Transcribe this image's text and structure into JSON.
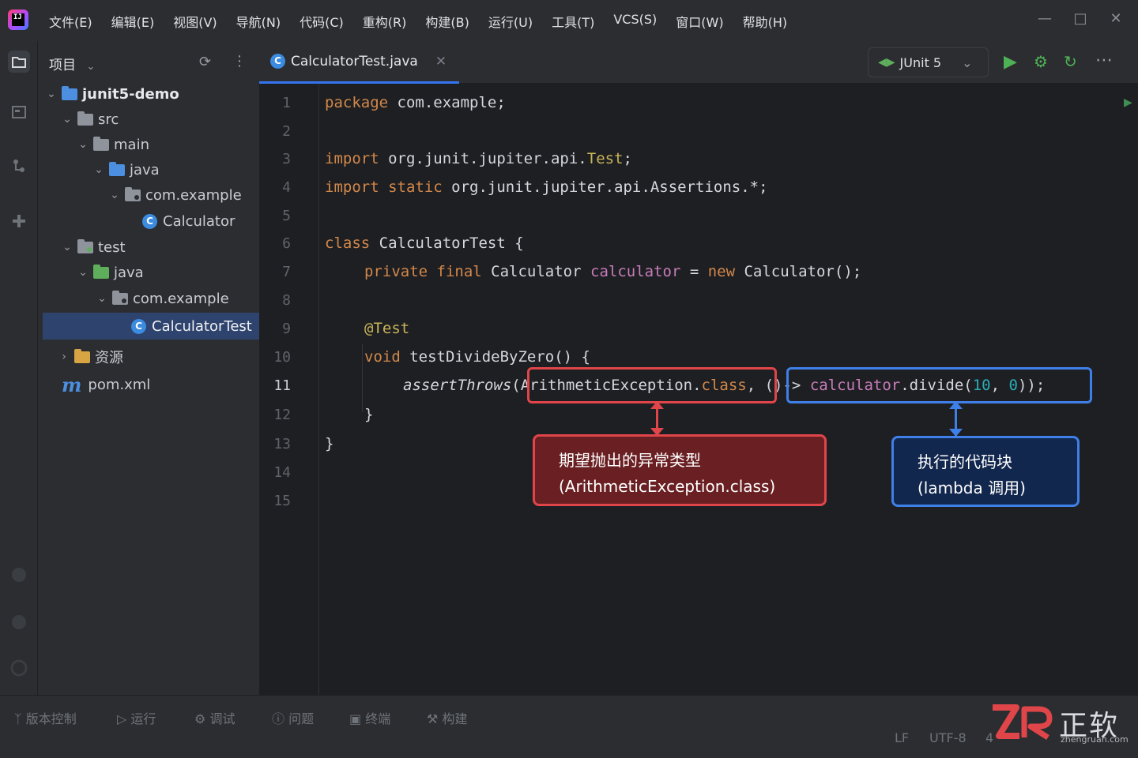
{
  "menu": [
    "文件(E)",
    "编辑(E)",
    "视图(V)",
    "导航(N)",
    "代码(C)",
    "重构(R)",
    "构建(B)",
    "运行(U)",
    "工具(T)",
    "VCS(S)",
    "窗口(W)",
    "帮助(H)"
  ],
  "project": {
    "header": "项目",
    "tree": [
      {
        "label": "junit5-demo",
        "depth": 0,
        "icon": "folder-module-icon",
        "expanded": true
      },
      {
        "label": "src",
        "depth": 1,
        "icon": "folder-icon",
        "expanded": true
      },
      {
        "label": "main",
        "depth": 2,
        "icon": "folder-icon",
        "expanded": true
      },
      {
        "label": "java",
        "depth": 3,
        "icon": "source-folder-icon",
        "expanded": true
      },
      {
        "label": "com.example",
        "depth": 4,
        "icon": "package-icon",
        "expanded": true
      },
      {
        "label": "Calculator",
        "depth": 5,
        "icon": "class-icon"
      },
      {
        "label": "test",
        "depth": 1,
        "icon": "folder-icon",
        "expanded": true
      },
      {
        "label": "java",
        "depth": 2,
        "icon": "test-source-folder-icon",
        "expanded": true
      },
      {
        "label": "com.example",
        "depth": 3,
        "icon": "package-icon",
        "expanded": true
      },
      {
        "label": "CalculatorTest",
        "depth": 4,
        "icon": "class-icon",
        "selected": true
      },
      {
        "label": "资源",
        "depth": 1,
        "icon": "resources-folder-icon",
        "expanded": false
      },
      {
        "label": "pom.xml",
        "depth": 0,
        "icon": "maven-icon"
      }
    ]
  },
  "editor": {
    "tab": "CalculatorTest.java",
    "run_config": "JUnit 5",
    "current_line": 11,
    "line_numbers": [
      "1",
      "2",
      "3",
      "4",
      "5",
      "6",
      "7",
      "8",
      "9",
      "10",
      "11",
      "12",
      "13",
      "14",
      "15"
    ]
  },
  "code": {
    "l1_kw": "package",
    "l1_rest": " com.example;",
    "l3_kw": "import",
    "l3_rest": " org.junit.jupiter.api.",
    "l3_cls": "Test",
    "l3_end": ";",
    "l4_kw": "import static",
    "l4_rest": " org.junit.jupiter.api.Assertions.*;",
    "l6_kw": "class",
    "l6_rest": " CalculatorTest {",
    "l7_kw": "private final",
    "l7_type": " Calculator ",
    "l7_field": "calculator",
    "l7_eq": " = ",
    "l7_new": "new",
    "l7_rest": " Calculator();",
    "l9_ann": "@Test",
    "l10_kw": "void",
    "l10_rest": " testDivideByZero() {",
    "l11_call": "assertThrows",
    "l11_paren": "(",
    "l11_exc": "ArithmeticException.",
    "l11_class": "class",
    "l11_comma": ",",
    "l11_lambda": " ()->",
    "l11_field": " calculator",
    "l11_call2": ".divide(",
    "l11_n1": "10",
    "l11_sep": ", ",
    "l11_n2": "0",
    "l11_end": "));",
    "l12": "}",
    "l13": "}"
  },
  "callouts": {
    "red_line1": "期望抛出的异常类型",
    "red_line2": "(ArithmeticException.class)",
    "blue_line1": "执行的代码块",
    "blue_line2": "(lambda 调用)"
  },
  "bottom": {
    "tools": [
      "版本控制",
      "运行",
      "调试",
      "问题",
      "终端",
      "构建"
    ],
    "status_lf": "LF",
    "status_encoding": "UTF-8",
    "status_indent": "4"
  },
  "watermark": {
    "brand": "正软",
    "site": "zhengruan.com"
  },
  "colors": {
    "accent": "#3574f0",
    "highlight_red": "#e0454a",
    "highlight_blue": "#3f7fe8",
    "keyword": "#d2884b"
  }
}
